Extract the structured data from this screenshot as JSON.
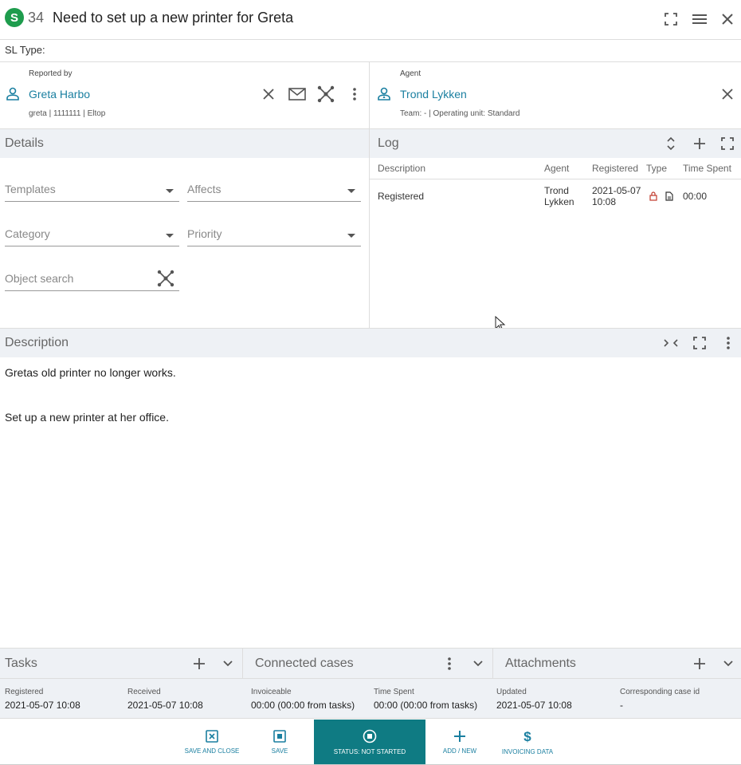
{
  "header": {
    "badge": "S",
    "case_number": "34",
    "title": "Need to set up a new printer for Greta"
  },
  "sl_type_label": "SL Type:",
  "reported_by": {
    "label": "Reported by",
    "name": "Greta Harbo",
    "meta": "greta | 1111111 | Eltop"
  },
  "agent": {
    "label": "Agent",
    "name": "Trond Lykken",
    "meta": "Team: - | Operating unit: Standard"
  },
  "details": {
    "title": "Details",
    "templates": "Templates",
    "affects": "Affects",
    "category": "Category",
    "priority": "Priority",
    "object_search": "Object search"
  },
  "log": {
    "title": "Log",
    "columns": [
      "Description",
      "Agent",
      "Registered",
      "Type",
      "Time Spent"
    ],
    "rows": [
      {
        "description": "Registered",
        "agent_line1": "Trond",
        "agent_line2": "Lykken",
        "registered_line1": "2021-05-07",
        "registered_line2": "10:08",
        "time_spent": "00:00"
      }
    ]
  },
  "description": {
    "title": "Description",
    "line1": "Gretas old printer no longer works.",
    "line2": "Set up a new printer at her office."
  },
  "panels": {
    "tasks": "Tasks",
    "connected_cases": "Connected cases",
    "attachments": "Attachments"
  },
  "info": [
    {
      "label": "Registered",
      "value": "2021-05-07 10:08"
    },
    {
      "label": "Received",
      "value": "2021-05-07 10:08"
    },
    {
      "label": "Invoiceable",
      "value": "00:00 (00:00 from tasks)"
    },
    {
      "label": "Time Spent",
      "value": "00:00 (00:00 from tasks)"
    },
    {
      "label": "Updated",
      "value": "2021-05-07 10:08"
    },
    {
      "label": "Corresponding case id",
      "value": "-"
    }
  ],
  "footer": {
    "save_and_close": "SAVE AND CLOSE",
    "save": "SAVE",
    "status": "STATUS: NOT STARTED",
    "add_new": "ADD / NEW",
    "invoicing_data": "INVOICING DATA"
  },
  "colors": {
    "accent": "#1a7fa0",
    "status_bg": "#0f7b83",
    "badge": "#1e9c4d",
    "lock": "#c0392b"
  }
}
